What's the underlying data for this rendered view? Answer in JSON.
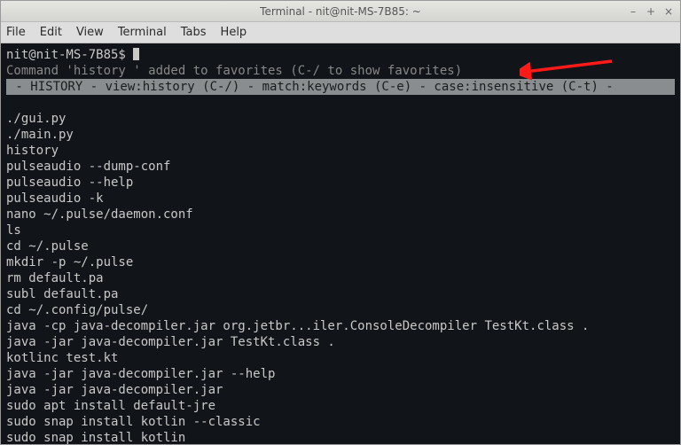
{
  "window": {
    "title": "Terminal - nit@nit-MS-7B85: ~"
  },
  "menu": {
    "items": [
      "File",
      "Edit",
      "View",
      "Terminal",
      "Tabs",
      "Help"
    ]
  },
  "prompt": "nit@nit-MS-7B85$ ",
  "message": "Command 'history ' added to favorites (C-/ to show favorites)",
  "status": " - HISTORY - view:history (C-/) - match:keywords (C-e) - case:insensitive (C-t) -",
  "history": [
    "./gui.py",
    "./main.py",
    "history",
    "pulseaudio --dump-conf",
    "pulseaudio --help",
    "pulseaudio -k",
    "nano ~/.pulse/daemon.conf",
    "ls",
    "cd ~/.pulse",
    "mkdir -p ~/.pulse",
    "rm default.pa",
    "subl default.pa",
    "cd ~/.config/pulse/",
    "java -cp java-decompiler.jar org.jetbr...iler.ConsoleDecompiler TestKt.class .",
    "java -jar java-decompiler.jar TestKt.class .",
    "kotlinc test.kt",
    "java -jar java-decompiler.jar --help",
    "java -jar java-decompiler.jar",
    "sudo apt install default-jre",
    "sudo snap install kotlin --classic",
    "sudo snap install kotlin"
  ],
  "win_controls": {
    "min": "–",
    "max": "+",
    "close": "×"
  },
  "arrow_color": "#ff1a1a"
}
